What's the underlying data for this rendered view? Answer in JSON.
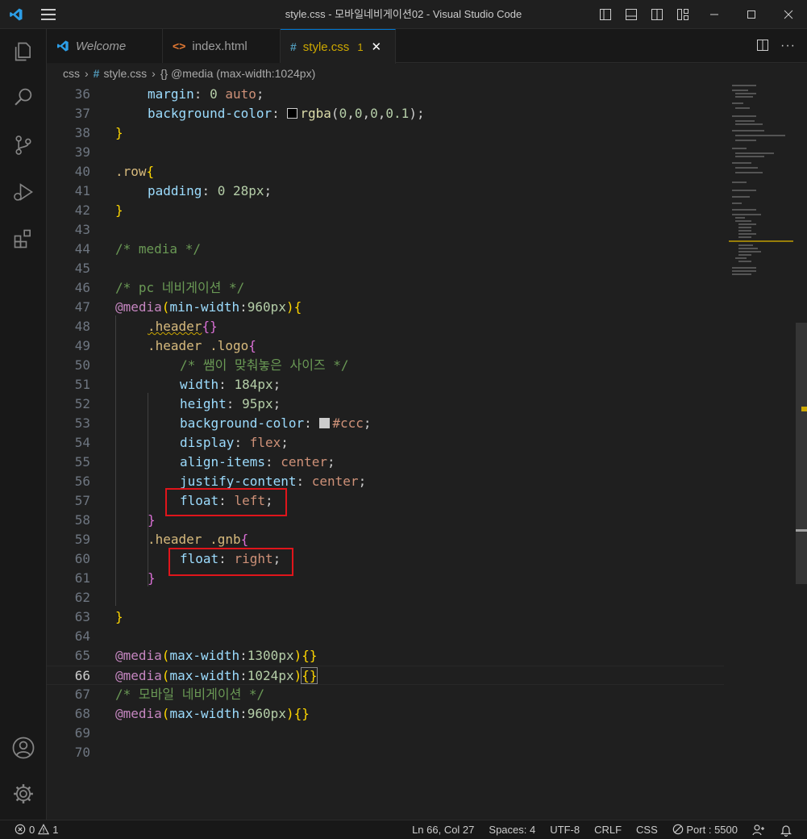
{
  "window": {
    "title": "style.css - 모바일네비게이션02 - Visual Studio Code"
  },
  "tabs": [
    {
      "label": "Welcome",
      "icon": "vscode-icon",
      "active": false
    },
    {
      "label": "index.html",
      "icon": "html-icon",
      "active": false
    },
    {
      "label": "style.css",
      "icon": "css-hash-icon",
      "active": true,
      "problems": "1"
    }
  ],
  "breadcrumb": {
    "folder": "css",
    "file": "style.css",
    "symbol": "{} @media (max-width:1024px)"
  },
  "editor": {
    "lines": [
      {
        "n": "36",
        "indent": 1,
        "tokens": [
          [
            "margin",
            "prop"
          ],
          [
            ": ",
            "pun"
          ],
          [
            "0",
            "num"
          ],
          [
            " ",
            "pun"
          ],
          [
            "auto",
            "val"
          ],
          [
            ";",
            "pun"
          ]
        ]
      },
      {
        "n": "37",
        "indent": 1,
        "tokens": [
          [
            "background-color",
            "prop"
          ],
          [
            ": ",
            "pun"
          ],
          [
            "SW:#000000",
            "swatch"
          ],
          [
            "rgba",
            "fn"
          ],
          [
            "(",
            "pun"
          ],
          [
            "0",
            "num"
          ],
          [
            ",",
            "pun"
          ],
          [
            "0",
            "num"
          ],
          [
            ",",
            "pun"
          ],
          [
            "0",
            "num"
          ],
          [
            ",",
            "pun"
          ],
          [
            "0.1",
            "num"
          ],
          [
            ")",
            "pun"
          ],
          [
            ";",
            "pun"
          ]
        ]
      },
      {
        "n": "38",
        "indent": 0,
        "tokens": [
          [
            "}",
            "br1"
          ]
        ]
      },
      {
        "n": "39",
        "indent": 0,
        "tokens": []
      },
      {
        "n": "40",
        "indent": 0,
        "tokens": [
          [
            ".row",
            "sel"
          ],
          [
            "{",
            "br1"
          ]
        ]
      },
      {
        "n": "41",
        "indent": 1,
        "tokens": [
          [
            "padding",
            "prop"
          ],
          [
            ": ",
            "pun"
          ],
          [
            "0",
            "num"
          ],
          [
            " ",
            "pun"
          ],
          [
            "28px",
            "num"
          ],
          [
            ";",
            "pun"
          ]
        ]
      },
      {
        "n": "42",
        "indent": 0,
        "tokens": [
          [
            "}",
            "br1"
          ]
        ]
      },
      {
        "n": "43",
        "indent": 0,
        "tokens": []
      },
      {
        "n": "44",
        "indent": 0,
        "tokens": [
          [
            "/* media */",
            "cmt"
          ]
        ]
      },
      {
        "n": "45",
        "indent": 0,
        "tokens": []
      },
      {
        "n": "46",
        "indent": 0,
        "tokens": [
          [
            "/* pc 네비게이션 */",
            "cmt"
          ]
        ]
      },
      {
        "n": "47",
        "indent": 0,
        "tokens": [
          [
            "@media",
            "at"
          ],
          [
            "(",
            "br1"
          ],
          [
            "min-width",
            "prop"
          ],
          [
            ":",
            "pun"
          ],
          [
            "960px",
            "num"
          ],
          [
            ")",
            "br1"
          ],
          [
            "{",
            "br1"
          ]
        ]
      },
      {
        "n": "48",
        "indent": 1,
        "tokens": [
          [
            ".header",
            "sel squig"
          ],
          [
            "{}",
            "br2"
          ]
        ]
      },
      {
        "n": "49",
        "indent": 1,
        "tokens": [
          [
            ".header .logo",
            "sel"
          ],
          [
            "{",
            "br2"
          ]
        ]
      },
      {
        "n": "50",
        "indent": 2,
        "tokens": [
          [
            "/* 쌤이 맞춰놓은 사이즈 */",
            "cmt"
          ]
        ]
      },
      {
        "n": "51",
        "indent": 2,
        "tokens": [
          [
            "width",
            "prop"
          ],
          [
            ": ",
            "pun"
          ],
          [
            "184px",
            "num"
          ],
          [
            ";",
            "pun"
          ]
        ]
      },
      {
        "n": "52",
        "indent": 2,
        "tokens": [
          [
            "height",
            "prop"
          ],
          [
            ": ",
            "pun"
          ],
          [
            "95px",
            "num"
          ],
          [
            ";",
            "pun"
          ]
        ]
      },
      {
        "n": "53",
        "indent": 2,
        "tokens": [
          [
            "background-color",
            "prop"
          ],
          [
            ": ",
            "pun"
          ],
          [
            "SW:#cccccc",
            "swatch"
          ],
          [
            "#ccc",
            "val"
          ],
          [
            ";",
            "pun"
          ]
        ]
      },
      {
        "n": "54",
        "indent": 2,
        "tokens": [
          [
            "display",
            "prop"
          ],
          [
            ": ",
            "pun"
          ],
          [
            "flex",
            "val"
          ],
          [
            ";",
            "pun"
          ]
        ]
      },
      {
        "n": "55",
        "indent": 2,
        "tokens": [
          [
            "align-items",
            "prop"
          ],
          [
            ": ",
            "pun"
          ],
          [
            "center",
            "val"
          ],
          [
            ";",
            "pun"
          ]
        ]
      },
      {
        "n": "56",
        "indent": 2,
        "tokens": [
          [
            "justify-content",
            "prop"
          ],
          [
            ": ",
            "pun"
          ],
          [
            "center",
            "val"
          ],
          [
            ";",
            "pun"
          ]
        ]
      },
      {
        "n": "57",
        "indent": 2,
        "tokens": [
          [
            "float",
            "prop"
          ],
          [
            ": ",
            "pun"
          ],
          [
            "left",
            "val"
          ],
          [
            ";",
            "pun"
          ]
        ]
      },
      {
        "n": "58",
        "indent": 1,
        "tokens": [
          [
            "}",
            "br2"
          ]
        ]
      },
      {
        "n": "59",
        "indent": 1,
        "tokens": [
          [
            ".header .gnb",
            "sel"
          ],
          [
            "{",
            "br2"
          ]
        ]
      },
      {
        "n": "60",
        "indent": 2,
        "tokens": [
          [
            "float",
            "prop"
          ],
          [
            ": ",
            "pun"
          ],
          [
            "right",
            "val"
          ],
          [
            ";",
            "pun"
          ]
        ]
      },
      {
        "n": "61",
        "indent": 1,
        "tokens": [
          [
            "}",
            "br2"
          ]
        ]
      },
      {
        "n": "62",
        "indent": 0,
        "tokens": []
      },
      {
        "n": "63",
        "indent": 0,
        "tokens": [
          [
            "}",
            "br1"
          ]
        ]
      },
      {
        "n": "64",
        "indent": 0,
        "tokens": []
      },
      {
        "n": "65",
        "indent": 0,
        "tokens": [
          [
            "@media",
            "at"
          ],
          [
            "(",
            "br1"
          ],
          [
            "max-width",
            "prop"
          ],
          [
            ":",
            "pun"
          ],
          [
            "1300px",
            "num"
          ],
          [
            ")",
            "br1"
          ],
          [
            "{}",
            "br1"
          ]
        ]
      },
      {
        "n": "66",
        "indent": 0,
        "tokens": [
          [
            "@media",
            "at"
          ],
          [
            "(",
            "br1"
          ],
          [
            "max-width",
            "prop"
          ],
          [
            ":",
            "pun"
          ],
          [
            "1024px",
            "num"
          ],
          [
            ")",
            "br1"
          ],
          [
            "{}",
            "br1 match"
          ]
        ]
      },
      {
        "n": "67",
        "indent": 0,
        "tokens": [
          [
            "/* 모바일 네비게이션 */",
            "cmt"
          ]
        ]
      },
      {
        "n": "68",
        "indent": 0,
        "tokens": [
          [
            "@media",
            "at"
          ],
          [
            "(",
            "br1"
          ],
          [
            "max-width",
            "prop"
          ],
          [
            ":",
            "pun"
          ],
          [
            "960px",
            "num"
          ],
          [
            ")",
            "br1"
          ],
          [
            "{}",
            "br1"
          ]
        ]
      },
      {
        "n": "69",
        "indent": 0,
        "tokens": []
      },
      {
        "n": "70",
        "indent": 0,
        "tokens": []
      }
    ],
    "current_line": "66",
    "highlighted_lines": [
      "57",
      "60"
    ]
  },
  "statusbar": {
    "errors": "0",
    "warnings": "1",
    "position": "Ln 66, Col 27",
    "spaces": "Spaces: 4",
    "encoding": "UTF-8",
    "eol": "CRLF",
    "language": "CSS",
    "port": "Port : 5500"
  },
  "colors": {
    "accent": "#0078d4",
    "annotation": "#e0151b",
    "warning": "#cca700"
  }
}
